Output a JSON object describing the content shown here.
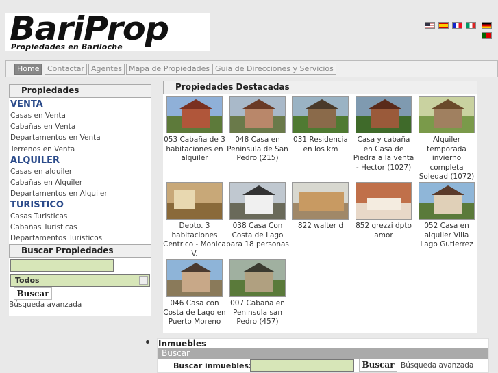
{
  "header": {
    "logo_main": "BariProp",
    "logo_sub": "Propiedades en Bariloche",
    "flags": [
      "flag-us-icon",
      "flag-es-icon",
      "flag-fr-icon",
      "flag-it-icon",
      "flag-de-icon",
      "flag-pt-icon"
    ]
  },
  "nav": {
    "items": [
      "Home",
      "Contactar",
      "Agentes",
      "Mapa de Propiedades",
      "Guia de Direcciones y Servicios"
    ]
  },
  "sidebar": {
    "title": "Propiedades",
    "venta": {
      "title": "VENTA",
      "items": [
        "Casas en Venta",
        "Cabañas en Venta",
        "Departamentos en Venta",
        "Terrenos en Venta"
      ]
    },
    "alquiler": {
      "title": "ALQUILER",
      "items": [
        "Casas en alquiler",
        "Cabañas en Alquiler",
        "Departamentos en Alquiler"
      ]
    },
    "turistico": {
      "title": "TURISTICO",
      "items": [
        "Casas Turisticas",
        "Cabañas Turisticas",
        "Departamentos Turisticos"
      ]
    },
    "search": {
      "title": "Buscar Propiedades",
      "select_value": "Todos",
      "button": "Buscar",
      "advanced": "Búsqueda avanzada"
    }
  },
  "main": {
    "title": "Propiedades Destacadas",
    "properties": [
      "053 Cabaña de 3 habitaciones en alquiler",
      "048 Casa en Peninsula de San Pedro (215)",
      "031 Residencia en los km",
      "Casa y cabaña en Casa de Piedra a la venta - Hector (1027)",
      "Alquiler temporada invierno completa Soledad (1072)",
      "Depto. 3 habitaciones Centrico - Monica V.",
      "038 Casa Con Costa de Lago para 18 personas",
      "822 walter d",
      "852 grezzi dpto amor",
      "052 Casa en alquiler Villa Lago Gutierrez",
      "046 Casa con Costa de Lago en Puerto Moreno",
      "007 Cabaña en Peninsula san Pedro (457)"
    ]
  },
  "inmuebles": {
    "title": "Inmuebles",
    "bar": "Buscar",
    "label": "Buscar inmuebles:",
    "button": "Buscar",
    "advanced": "Búsqueda avanzada"
  }
}
